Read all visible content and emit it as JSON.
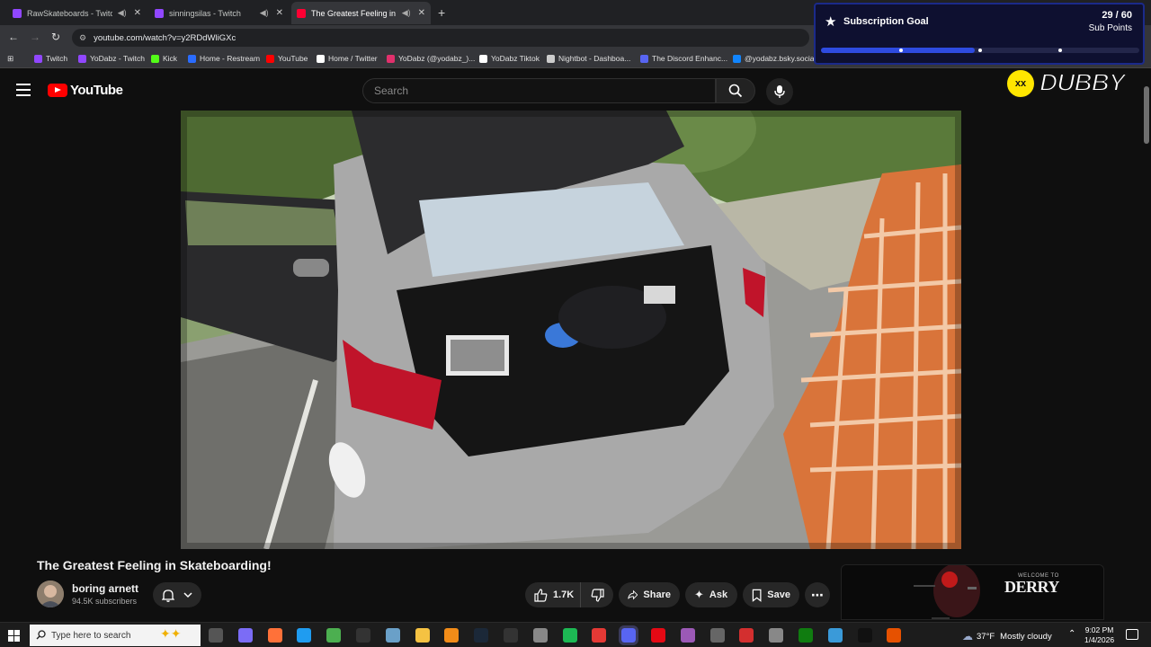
{
  "browser": {
    "tabs": [
      {
        "title": "RawSkateboards - Twitch",
        "site": "twitch"
      },
      {
        "title": "sinningsilas - Twitch",
        "site": "twitch"
      },
      {
        "title": "The Greatest Feeling in Ska",
        "site": "youtube"
      }
    ],
    "url": "youtube.com/watch?v=y2RDdWliGXc",
    "bookmarks": [
      {
        "label": "Twitch",
        "color": "#9147ff"
      },
      {
        "label": "YoDabz - Twitch",
        "color": "#9147ff"
      },
      {
        "label": "Kick",
        "color": "#53fc18"
      },
      {
        "label": "Home - Restream",
        "color": "#2a6cff"
      },
      {
        "label": "YouTube",
        "color": "#ff0000"
      },
      {
        "label": "Home / Twitter",
        "color": "#ffffff"
      },
      {
        "label": "YoDabz (@yodabz_)...",
        "color": "#e1306c"
      },
      {
        "label": "YoDabz Tiktok",
        "color": "#ffffff"
      },
      {
        "label": "Nightbot - Dashboa...",
        "color": "#cccccc"
      },
      {
        "label": "The Discord Enhanc...",
        "color": "#5865f2"
      },
      {
        "label": "@yodabz.bsky.socia...",
        "color": "#1185fe"
      }
    ]
  },
  "youtube": {
    "wordmark": "YouTube",
    "search_placeholder": "Search"
  },
  "overlay": {
    "goal_title": "Subscription Goal",
    "goal_count": "29 / 60",
    "goal_unit": "Sub Points",
    "goal_progress": 0.483,
    "dubby_text": "DUBBY",
    "dubby_face": "xx"
  },
  "video": {
    "title": "The Greatest Feeling in Skateboarding!",
    "channel": "boring arnett",
    "subscribers": "94.5K subscribers",
    "likes": "1.7K",
    "share_label": "Share",
    "ask_label": "Ask",
    "save_label": "Save",
    "ad_brand": "DERRY",
    "ad_prefix": "WELCOME TO"
  },
  "taskbar": {
    "search_placeholder": "Type here to search",
    "temperature": "37°F",
    "weather": "Mostly cloudy",
    "time": "9:02 PM",
    "date": "1/4/2026"
  }
}
